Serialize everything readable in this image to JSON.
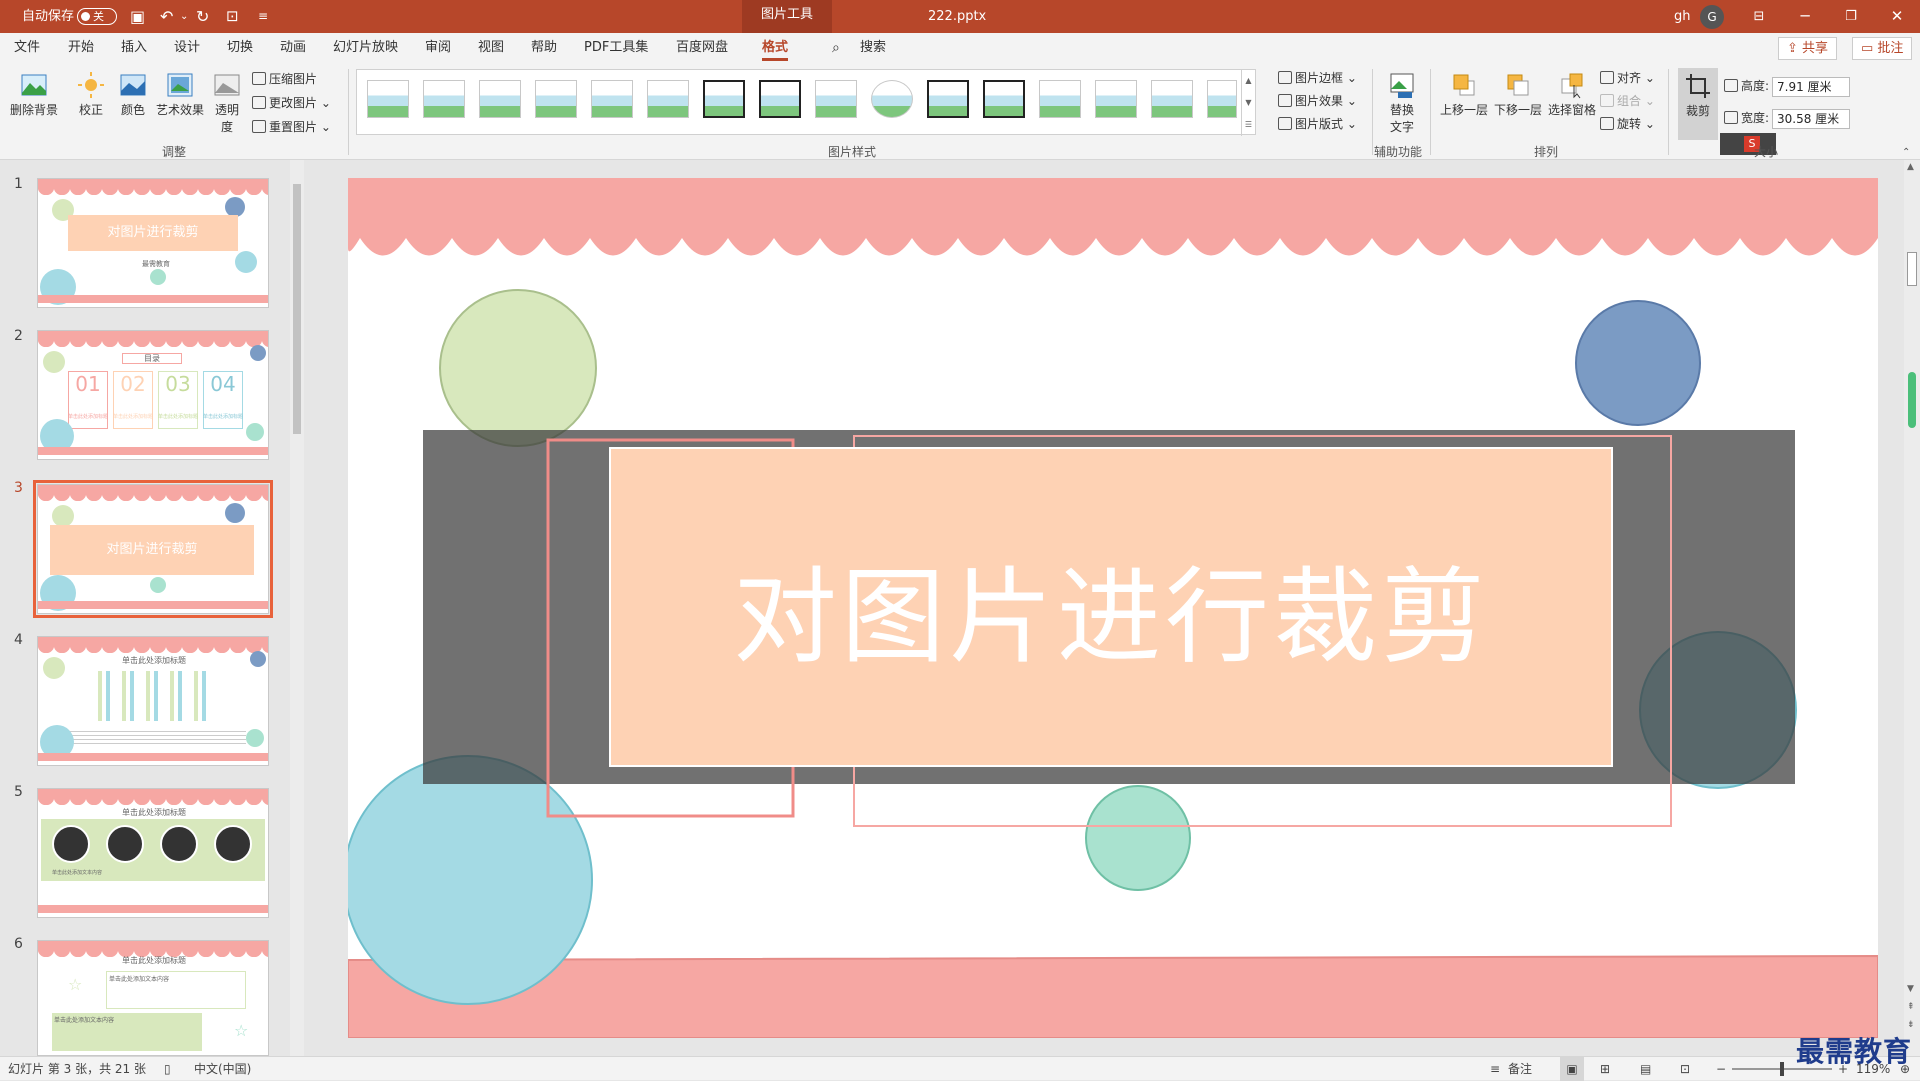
{
  "titlebar": {
    "autosave_label": "自动保存",
    "autosave_state": "关",
    "context_tab": "图片工具",
    "file_name": "222.pptx",
    "user": "gh",
    "avatar_letter": "G"
  },
  "menu": {
    "items": [
      "文件",
      "开始",
      "插入",
      "设计",
      "切换",
      "动画",
      "幻灯片放映",
      "审阅",
      "视图",
      "帮助",
      "PDF工具集",
      "百度网盘",
      "格式"
    ],
    "active": "格式",
    "search_label": "搜索",
    "share_label": "共享",
    "comment_label": "批注"
  },
  "ribbon": {
    "remove_bg": "删除背景",
    "correct": "校正",
    "color": "颜色",
    "art_effect": "艺术效果",
    "transparency": "透明度",
    "compress": "压缩图片",
    "change": "更改图片",
    "reset": "重置图片",
    "adjust_group": "调整",
    "pic_border": "图片边框",
    "pic_effect": "图片效果",
    "pic_layout": "图片版式",
    "style_group": "图片样式",
    "alt_text": "替换文字",
    "access_group": "辅助功能",
    "bring_forward": "上移一层",
    "send_backward": "下移一层",
    "selection_pane": "选择窗格",
    "align": "对齐",
    "group": "组合",
    "rotate": "旋转",
    "arrange_group": "排列",
    "crop": "裁剪",
    "height_label": "高度:",
    "height_value": "7.91 厘米",
    "width_label": "宽度:",
    "width_value": "30.58 厘米",
    "size_group": "大小"
  },
  "thumbnails": [
    {
      "num": "1",
      "title": "对图片进行裁剪",
      "sub": "最需教育"
    },
    {
      "num": "2",
      "title": "目录",
      "items": [
        "01",
        "02",
        "03",
        "04"
      ],
      "item_texts": [
        "单击此处添加标题",
        "单击此处添加标题",
        "单击此处添加标题",
        "单击此处添加标题"
      ]
    },
    {
      "num": "3",
      "title": "对图片进行裁剪",
      "selected": true
    },
    {
      "num": "4",
      "title": "单击此处添加标题"
    },
    {
      "num": "5",
      "title": "单击此处添加标题",
      "item_text": "单击此处添加文本内容"
    },
    {
      "num": "6",
      "title": "单击此处添加标题",
      "item_text": "单击此处添加文本内容"
    }
  ],
  "slide": {
    "title": "对图片进行裁剪"
  },
  "status": {
    "slide_info": "幻灯片 第 3 张，共 21 张",
    "language": "中文(中国)",
    "notes": "备注",
    "zoom": "119%"
  },
  "watermark": "最需教育",
  "colors": {
    "accent": "#b7472a",
    "pink": "#f6a7a3",
    "peach": "#fed2b4",
    "green": "#d8e8bd",
    "blue": "#7b9bc4",
    "teal": "#a4dae4",
    "mint": "#a9e2cf"
  }
}
